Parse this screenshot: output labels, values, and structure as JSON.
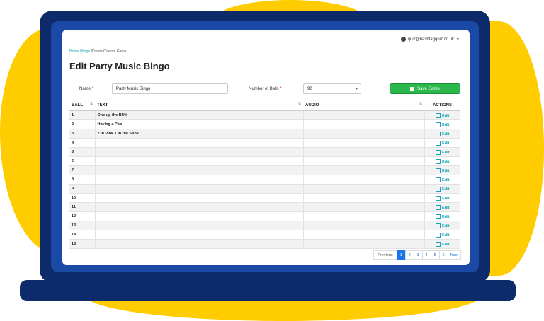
{
  "user": {
    "email": "quiz@hashtagquiz.co.uk"
  },
  "breadcrumb": {
    "home": "Home",
    "bingo": "/Bingo",
    "current": "/Create Custom Game"
  },
  "page_title": "Edit Party Music Bingo",
  "form": {
    "name_label": "Name",
    "name_value": "Party Music Bingo",
    "balls_label": "Number of Balls",
    "balls_value": "90",
    "save_label": "Save Game"
  },
  "table": {
    "headers": {
      "ball": "BALL",
      "text": "TEXT",
      "audio": "AUDIO",
      "actions": "ACTIONS"
    },
    "action_label": "Edit",
    "rows": [
      {
        "ball": "1",
        "text": "One up the BUM",
        "audio": ""
      },
      {
        "ball": "2",
        "text": "Having a Poo",
        "audio": ""
      },
      {
        "ball": "3",
        "text": "2 in Pink 1 in the Stink",
        "audio": ""
      },
      {
        "ball": "4",
        "text": "",
        "audio": ""
      },
      {
        "ball": "5",
        "text": "",
        "audio": ""
      },
      {
        "ball": "6",
        "text": "",
        "audio": ""
      },
      {
        "ball": "7",
        "text": "",
        "audio": ""
      },
      {
        "ball": "8",
        "text": "",
        "audio": ""
      },
      {
        "ball": "9",
        "text": "",
        "audio": ""
      },
      {
        "ball": "10",
        "text": "",
        "audio": ""
      },
      {
        "ball": "11",
        "text": "",
        "audio": ""
      },
      {
        "ball": "12",
        "text": "",
        "audio": ""
      },
      {
        "ball": "13",
        "text": "",
        "audio": ""
      },
      {
        "ball": "14",
        "text": "",
        "audio": ""
      },
      {
        "ball": "15",
        "text": "",
        "audio": ""
      }
    ]
  },
  "pagination": {
    "previous": "Previous",
    "pages": [
      "1",
      "2",
      "3",
      "4",
      "5",
      "6"
    ],
    "next": "Next",
    "active": "1"
  },
  "colors": {
    "accent": "#1aa3b8",
    "save_green": "#2bb84a",
    "page_active": "#1a73e8",
    "laptop": "#0d2a6b",
    "blob": "#ffcc00"
  }
}
